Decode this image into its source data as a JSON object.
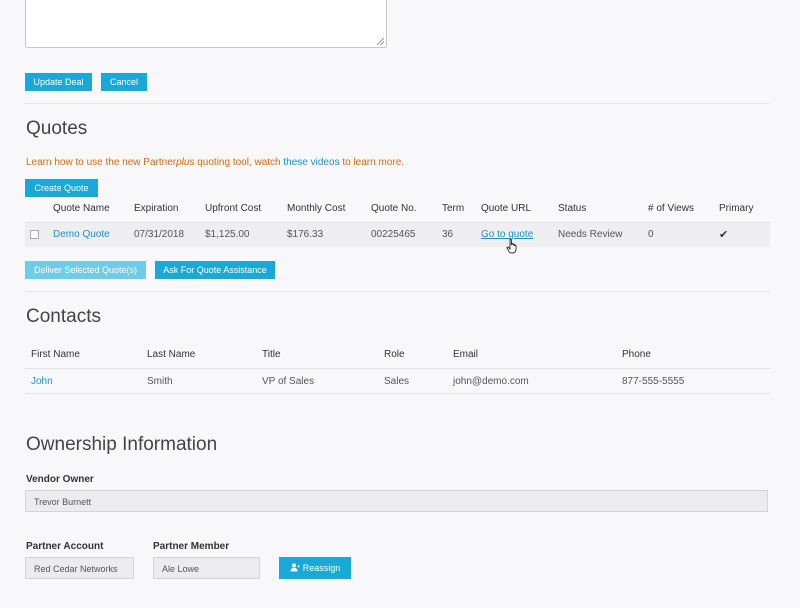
{
  "deal": {
    "update_label": "Update Deal",
    "cancel_label": "Cancel"
  },
  "quotes": {
    "title": "Quotes",
    "info_prefix": "Learn how to use the new Partner",
    "info_italic": "plus",
    "info_mid": " quoting tool, watch ",
    "info_link": "these videos",
    "info_suffix": " to learn more.",
    "create_label": "Create Quote",
    "columns": [
      "Quote Name",
      "Expiration",
      "Upfront Cost",
      "Monthly Cost",
      "Quote No.",
      "Term",
      "Quote URL",
      "Status",
      "# of Views",
      "Primary"
    ],
    "rows": [
      {
        "name": "Demo Quote",
        "expiration": "07/31/2018",
        "upfront": "$1,125.00",
        "monthly": "$176.33",
        "quote_no": "00225465",
        "term": "36",
        "url": "Go to quote",
        "status": "Needs Review",
        "views": "0",
        "primary": "✔"
      }
    ],
    "deliver_label": "Deliver Selected Quote(s)",
    "assist_label": "Ask For Quote Assistance"
  },
  "contacts": {
    "title": "Contacts",
    "columns": [
      "First Name",
      "Last Name",
      "Title",
      "Role",
      "Email",
      "Phone"
    ],
    "rows": [
      {
        "first": "John",
        "last": "Smith",
        "title": "VP of Sales",
        "role": "Sales",
        "email": "john@demo.com",
        "phone": "877-555-5555"
      }
    ]
  },
  "ownership": {
    "title": "Ownership Information",
    "vendor_owner_label": "Vendor Owner",
    "vendor_owner_value": "Trevor Burnett",
    "partner_account_label": "Partner Account",
    "partner_account_value": "Red Cedar Networks",
    "partner_member_label": "Partner Member",
    "partner_member_value": "Ale Lowe",
    "reassign_label": "Reassign"
  },
  "colors": {
    "accent": "#18a9d9",
    "link": "#1d8fcf",
    "notice": "#d56a12"
  }
}
